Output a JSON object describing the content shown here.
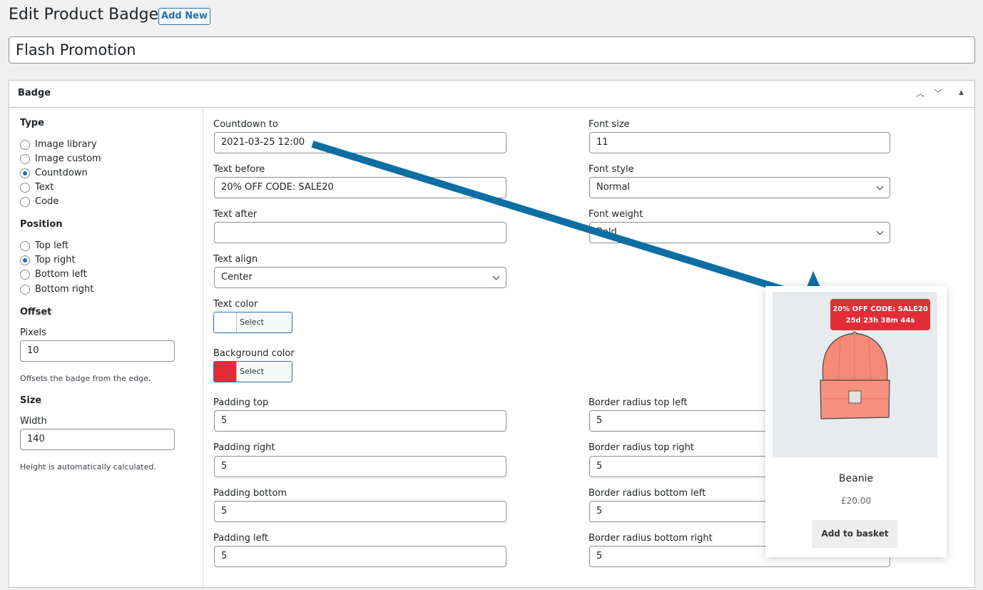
{
  "header": {
    "title": "Edit Product Badge",
    "add_new": "Add New"
  },
  "post_title": "Flash Promotion",
  "panel": {
    "title": "Badge",
    "controls": {
      "up": "︿",
      "down": "﹀",
      "collapse": "▲"
    }
  },
  "left": {
    "type_label": "Type",
    "type_options": [
      "Image library",
      "Image custom",
      "Countdown",
      "Text",
      "Code"
    ],
    "type_selected": "Countdown",
    "position_label": "Position",
    "position_options": [
      "Top left",
      "Top right",
      "Bottom left",
      "Bottom right"
    ],
    "position_selected": "Top right",
    "offset_label": "Offset",
    "pixels_label": "Pixels",
    "pixels_value": "10",
    "offset_hint": "Offsets the badge from the edge.",
    "size_label": "Size",
    "width_label": "Width",
    "width_value": "140",
    "height_hint": "Height is automatically calculated."
  },
  "fields": {
    "countdown_label": "Countdown to",
    "countdown_value": "2021-03-25 12:00",
    "text_before_label": "Text before",
    "text_before_value": "20% OFF CODE: SALE20",
    "text_after_label": "Text after",
    "text_after_value": "",
    "text_align_label": "Text align",
    "text_align_value": "Center",
    "text_color_label": "Text color",
    "text_color_button": "Select Colour",
    "text_color": "#ffffff",
    "bg_color_label": "Background color",
    "bg_color_button": "Select Colour",
    "bg_color": "#e22d37",
    "padding_top_label": "Padding top",
    "padding_top_value": "5",
    "padding_right_label": "Padding right",
    "padding_right_value": "5",
    "padding_bottom_label": "Padding bottom",
    "padding_bottom_value": "5",
    "padding_left_label": "Padding left",
    "padding_left_value": "5",
    "font_size_label": "Font size",
    "font_size_value": "11",
    "font_style_label": "Font style",
    "font_style_value": "Normal",
    "font_weight_label": "Font weight",
    "font_weight_value": "Bold",
    "br_tl_label": "Border radius top left",
    "br_tl_value": "5",
    "br_tr_label": "Border radius top right",
    "br_tr_value": "5",
    "br_bl_label": "Border radius bottom left",
    "br_bl_value": "5",
    "br_br_label": "Border radius bottom right",
    "br_br_value": "5"
  },
  "preview": {
    "badge_line1": "20% OFF CODE: SALE20",
    "badge_line2": "25d 23h 38m 44s",
    "product_name": "Beanie",
    "price": "£20.00",
    "add_to_basket": "Add to basket",
    "arrow_color": "#0c6fa3"
  }
}
